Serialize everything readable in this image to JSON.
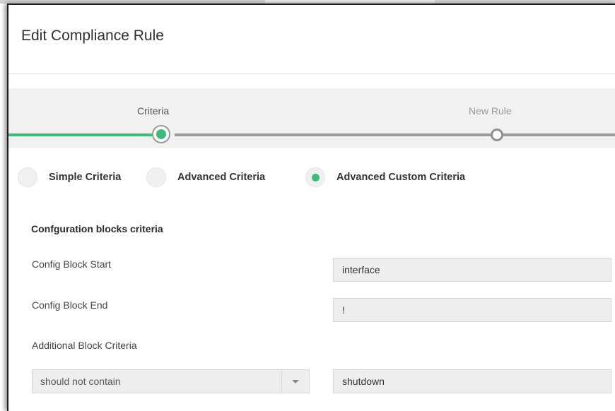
{
  "dialog": {
    "title": "Edit Compliance Rule"
  },
  "stepper": {
    "steps": [
      {
        "label": "Criteria",
        "state": "active"
      },
      {
        "label": "New Rule",
        "state": "inactive"
      }
    ],
    "progress_color": "#3cbc79"
  },
  "criteria_type": {
    "options": [
      {
        "label": "Simple Criteria",
        "checked": false
      },
      {
        "label": "Advanced Criteria",
        "checked": false
      },
      {
        "label": "Advanced Custom Criteria",
        "checked": true
      }
    ]
  },
  "config_blocks": {
    "section_title": "Confguration blocks criteria",
    "start": {
      "label": "Config Block Start",
      "value": "interface"
    },
    "end": {
      "label": "Config Block End",
      "value": "!"
    },
    "additional": {
      "label": "Additional Block Criteria",
      "condition": "should not contain",
      "value": "shutdown"
    }
  },
  "colors": {
    "accent": "#3cbc79",
    "input_bg": "#eeeeee"
  },
  "icons": [
    "chevron-down-icon"
  ]
}
